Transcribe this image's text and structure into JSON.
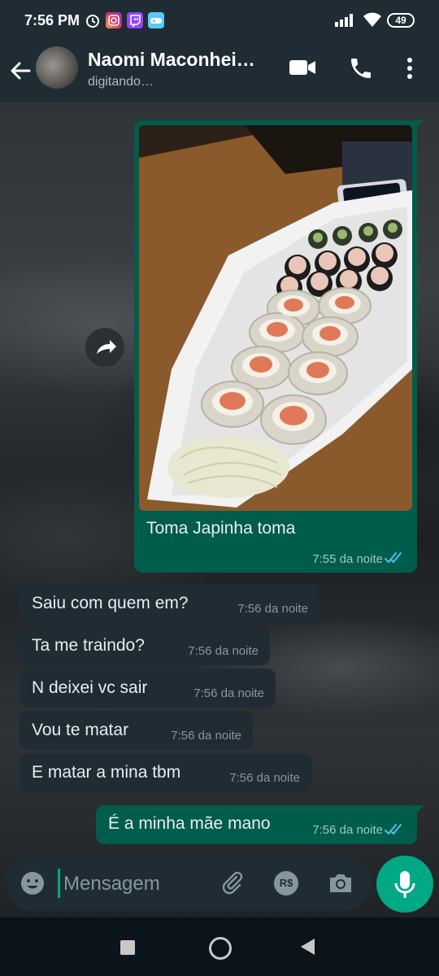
{
  "status_bar": {
    "time": "7:56 PM",
    "battery": "49",
    "icons": [
      "alarm-icon",
      "instagram-icon",
      "twitch-icon",
      "game-controller-icon",
      "signal-icon",
      "wifi-icon",
      "battery-icon"
    ]
  },
  "header": {
    "contact_name": "Naomi Maconhei…",
    "status": "digitando…",
    "icons": [
      "back-arrow-icon",
      "video-call-icon",
      "phone-icon",
      "more-vert-icon"
    ]
  },
  "messages": {
    "image_message": {
      "caption": "Toma Japinha toma",
      "time": "7:55 da noite",
      "read": true
    },
    "incoming": [
      {
        "text": "Saiu com quem em?",
        "time": "7:56 da noite"
      },
      {
        "text": "Ta me traindo?",
        "time": "7:56 da noite"
      },
      {
        "text": "N deixei vc sair",
        "time": "7:56 da noite"
      },
      {
        "text": "Vou te matar",
        "time": "7:56 da noite"
      },
      {
        "text": "E matar a mina tbm",
        "time": "7:56 da noite"
      }
    ],
    "outgoing_last": {
      "text": "É a minha mãe mano",
      "time": "7:56 da noite",
      "read": true
    }
  },
  "composer": {
    "placeholder": "Mensagem",
    "pay_label": "R$",
    "icons": [
      "emoji-icon",
      "attach-icon",
      "payment-icon",
      "camera-icon",
      "mic-icon"
    ]
  },
  "colors": {
    "header_bg": "#1f2c34",
    "outgoing_bubble": "#005c4b",
    "incoming_bubble": "#1f2c34",
    "accent": "#00a884",
    "read_ticks": "#53bdeb"
  }
}
